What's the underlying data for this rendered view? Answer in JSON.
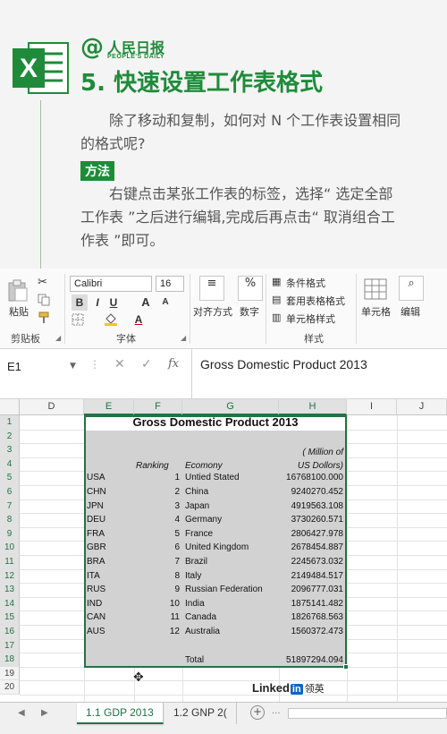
{
  "article": {
    "brand_at": "@",
    "brand_name": "人民日报",
    "brand_sub": "PEOPLE'S DAILY",
    "title": "5. 快速设置工作表格式",
    "intro": "除了移动和复制，如何对 N 个工作表设置相同的格式呢?",
    "method_label": "方法",
    "method_text": "右键点击某张工作表的标签，选择“ 选定全部工作表 ”之后进行编辑,完成后再点击“ 取消组合工作表 ”即可。"
  },
  "ribbon": {
    "paste_label": "粘贴",
    "clipboard_group": "剪贴板",
    "font_name": "Calibri",
    "font_size": "16",
    "font_group": "字体",
    "align_label": "对齐方式",
    "number_label": "数字",
    "cond_format": "条件格式",
    "table_format": "套用表格格式",
    "cell_style": "单元格样式",
    "style_group": "样式",
    "cells_label": "单元格",
    "edit_label": "编辑",
    "bold": "B",
    "italic": "I",
    "underline": "U",
    "grow": "A",
    "shrink": "A",
    "fontcolor": "A",
    "percent": "%"
  },
  "formula_bar": {
    "name_box": "E1",
    "formula": "Gross Domestic Product 2013",
    "fx": "fx",
    "cancel": "✕",
    "enter": "✓"
  },
  "grid": {
    "columns": [
      "D",
      "E",
      "F",
      "G",
      "H",
      "I",
      "J"
    ],
    "rows": [
      "1",
      "2",
      "3",
      "4",
      "5",
      "6",
      "7",
      "8",
      "9",
      "10",
      "11",
      "12",
      "13",
      "14",
      "15",
      "16",
      "17",
      "18",
      "19",
      "20"
    ],
    "title": "Gross Domestic Product 2013",
    "unit_line1": "( Million of",
    "unit_line2": "US Dollors)",
    "header_rank": "Ranking",
    "header_economy": "Ecomony",
    "data": [
      {
        "code": "USA",
        "rank": "1",
        "country": "Untied Stated",
        "gdp": "16768100.000"
      },
      {
        "code": "CHN",
        "rank": "2",
        "country": "China",
        "gdp": "9240270.452"
      },
      {
        "code": "JPN",
        "rank": "3",
        "country": "Japan",
        "gdp": "4919563.108"
      },
      {
        "code": "DEU",
        "rank": "4",
        "country": "Germany",
        "gdp": "3730260.571"
      },
      {
        "code": "FRA",
        "rank": "5",
        "country": "France",
        "gdp": "2806427.978"
      },
      {
        "code": "GBR",
        "rank": "6",
        "country": "United Kingdom",
        "gdp": "2678454.887"
      },
      {
        "code": "BRA",
        "rank": "7",
        "country": "Brazil",
        "gdp": "2245673.032"
      },
      {
        "code": "ITA",
        "rank": "8",
        "country": "Italy",
        "gdp": "2149484.517"
      },
      {
        "code": "RUS",
        "rank": "9",
        "country": "Russian Federation",
        "gdp": "2096777.031"
      },
      {
        "code": "IND",
        "rank": "10",
        "country": "India",
        "gdp": "1875141.482"
      },
      {
        "code": "CAN",
        "rank": "11",
        "country": "Canada",
        "gdp": "1826768.563"
      },
      {
        "code": "AUS",
        "rank": "12",
        "country": "Australia",
        "gdp": "1560372.473"
      }
    ],
    "total_label": "Total",
    "total_value": "51897294.094",
    "watermark_brand": "Linked",
    "watermark_in": "in",
    "watermark_cn": "领英"
  },
  "sheet_tabs": {
    "tabs": [
      "1.1 GDP 2013",
      "1.2 GNP 2("
    ],
    "add": "+",
    "nav_prev": "◀",
    "nav_next": "▶",
    "more": "..."
  },
  "colors": {
    "accent_green": "#1f8b3a",
    "excel_green": "#217346",
    "linkedin_blue": "#0a66c2",
    "selection_fill": "#d2d2d2"
  }
}
